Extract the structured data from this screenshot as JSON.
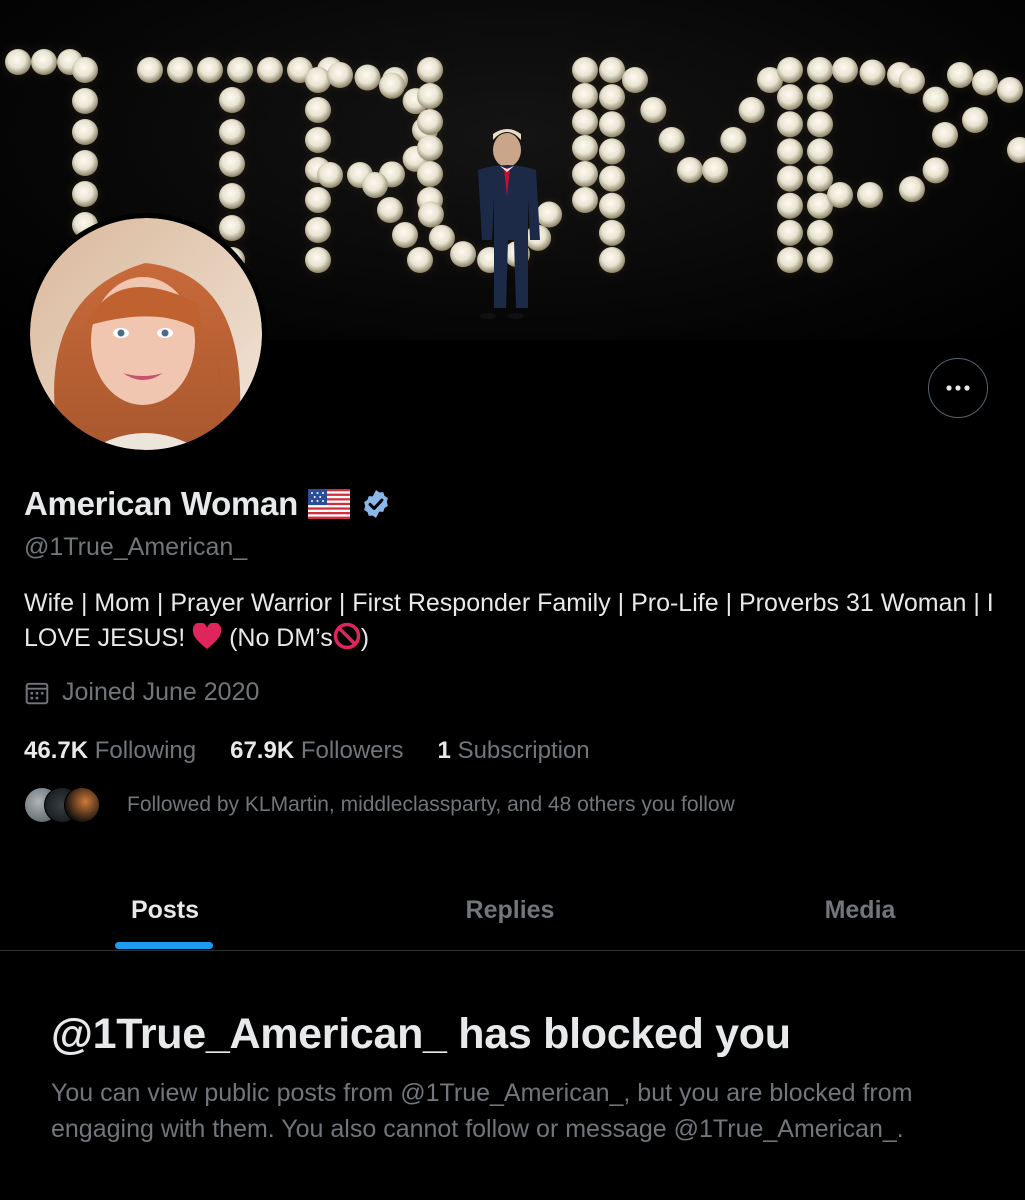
{
  "banner": {
    "marquee_text": "TRUMP"
  },
  "profile": {
    "display_name": "American Woman",
    "flag_emoji": "us-flag-icon",
    "verified_badge": "verified-badge-icon",
    "handle": "@1True_American_",
    "bio_main": "Wife | Mom | Prayer Warrior | First Responder Family | Pro-Life | Proverbs 31 Woman | I LOVE JESUS!",
    "bio_dm_open": "(No DM’s",
    "bio_dm_close": ")",
    "joined": "Joined June 2020",
    "following_count": "46.7K",
    "following_label": "Following",
    "followers_count": "67.9K",
    "followers_label": "Followers",
    "subscription_count": "1",
    "subscription_label": "Subscription",
    "followed_by": "Followed by KLMartin, middleclassparty, and 48 others you follow"
  },
  "tabs": [
    {
      "label": "Posts",
      "active": true
    },
    {
      "label": "Replies",
      "active": false
    },
    {
      "label": "Media",
      "active": false
    }
  ],
  "blocked": {
    "title": "@1True_American_ has blocked you",
    "body": "You can view public posts from @1True_American_, but you are blocked from engaging with them. You also cannot follow or message @1True_American_."
  },
  "colors": {
    "accent": "#1d9bf0",
    "verified": "#8bb8e8",
    "heart": "#e0245e",
    "muted": "#71767b"
  }
}
